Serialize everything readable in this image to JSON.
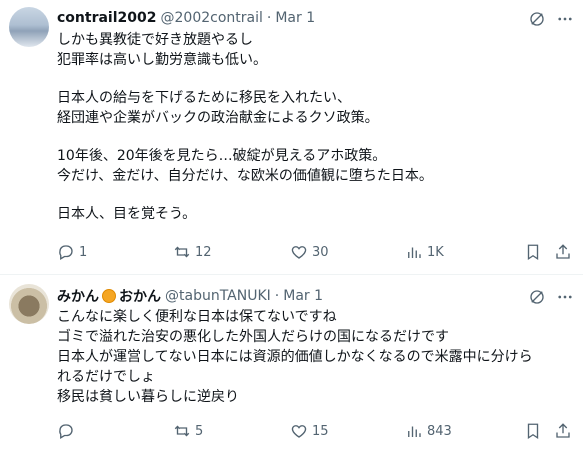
{
  "tweets": [
    {
      "name": "contrail2002",
      "handle": "@2002contrail",
      "dot": "·",
      "date": "Mar 1",
      "lines": [
        "しかも異教徒で好き放題やるし",
        "犯罪率は高いし勤労意識も低い。",
        "",
        "日本人の給与を下げるために移民を入れたい、",
        "経団連や企業がバックの政治献金によるクソ政策。",
        "",
        "10年後、20年後を見たら…破綻が見えるアホ政策。",
        "今だけ、金だけ、自分だけ、な欧米の価値観に堕ちた日本。",
        "",
        "日本人、目を覚そう。"
      ],
      "replies": "1",
      "retweets": "12",
      "likes": "30",
      "views": "1K"
    },
    {
      "name_part1": "みかん",
      "name_emoji": "orange-emoji",
      "name_part2": "おかん",
      "handle": "@tabunTANUKI",
      "dot": "·",
      "date": "Mar 1",
      "lines": [
        "こんなに楽しく便利な日本は保てないですね",
        "ゴミで溢れた治安の悪化した外国人だらけの国になるだけです",
        "日本人が運営してない日本には資源的価値しかなくなるので米露中に分けら",
        "れるだけでしょ",
        "移民は貧しい暮らしに逆戻り"
      ],
      "replies": "",
      "retweets": "5",
      "likes": "15",
      "views": "843"
    }
  ],
  "colors": {
    "text": "#0f1419",
    "secondary": "#536471",
    "divider": "#eff3f4"
  },
  "icons": [
    "grok-icon",
    "more-icon",
    "reply-icon",
    "retweet-icon",
    "like-icon",
    "views-icon",
    "bookmark-icon",
    "share-icon"
  ]
}
